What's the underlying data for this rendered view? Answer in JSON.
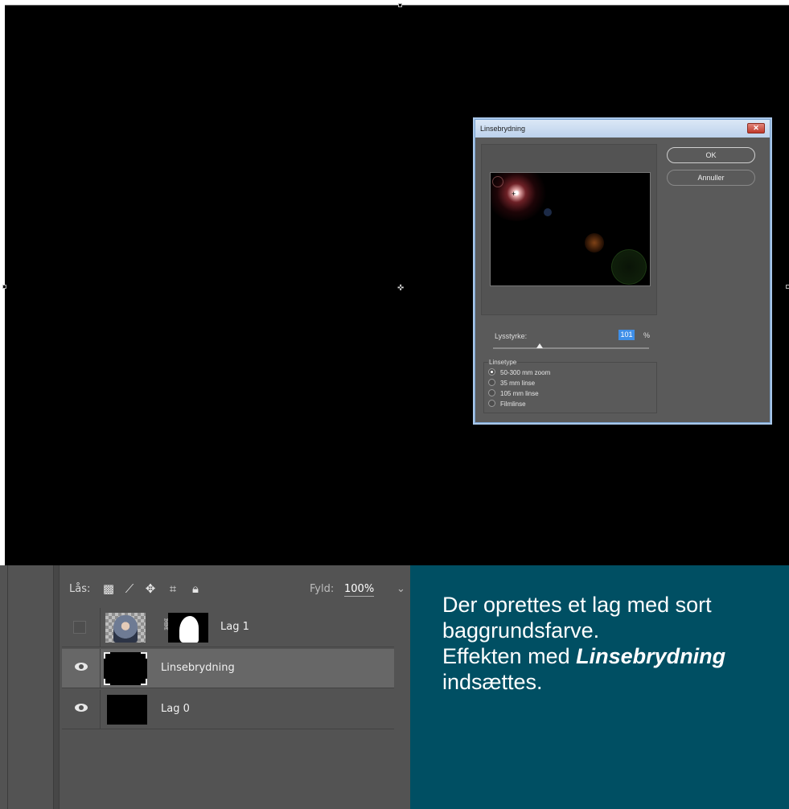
{
  "dialog": {
    "title": "Linsebrydning",
    "close_label": "✕",
    "ok_label": "OK",
    "cancel_label": "Annuller",
    "brightness_label": "Lysstyrke:",
    "brightness_value": "101",
    "brightness_unit": "%",
    "brightness_level": 0.3,
    "lens_type_title": "Linsetype",
    "lens_options": [
      {
        "label": "50-300 mm zoom",
        "checked": true
      },
      {
        "label": "35 mm linse",
        "checked": false
      },
      {
        "label": "105 mm linse",
        "checked": false
      },
      {
        "label": "Filmlinse",
        "checked": false
      }
    ]
  },
  "layers_panel": {
    "lock_label": "Lås:",
    "lock_icons": [
      "checkerboard-icon",
      "brush-icon",
      "move-icon",
      "artboard-icon",
      "lock-icon"
    ],
    "fill_label": "Fyld:",
    "fill_value": "100%",
    "layers": [
      {
        "name": "Lag 1",
        "visible": false,
        "selected": false
      },
      {
        "name": "Linsebrydning",
        "visible": true,
        "selected": true
      },
      {
        "name": "Lag 0",
        "visible": true,
        "selected": false
      }
    ]
  },
  "caption": {
    "line1": "Der oprettes et lag med sort baggrundsfarve.",
    "line2_prefix": "Effekten med ",
    "line2_emphasis": "Linsebrydning",
    "line2_suffix": " indsættes."
  }
}
